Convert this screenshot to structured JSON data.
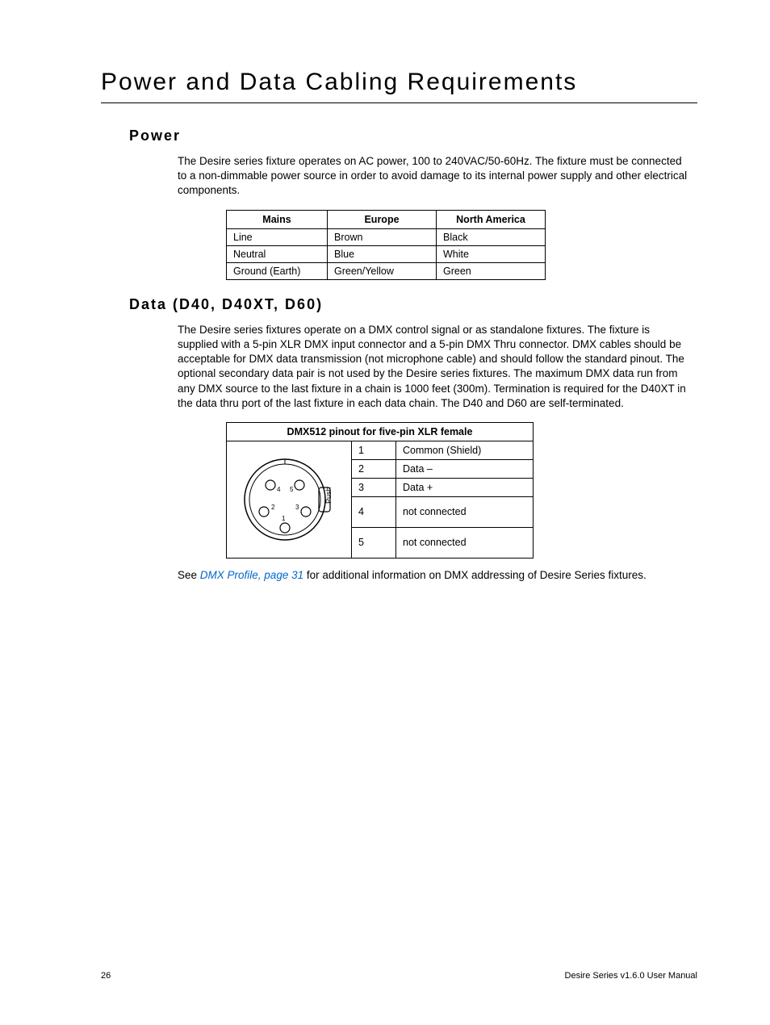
{
  "page_title": "Power and Data Cabling Requirements",
  "sections": {
    "power": {
      "heading": "Power",
      "paragraph": "The Desire series fixture operates on AC power, 100 to 240VAC/50-60Hz. The fixture must be connected to a non-dimmable power source in order to avoid damage to its internal power supply and other electrical components.",
      "table": {
        "headers": [
          "Mains",
          "Europe",
          "North America"
        ],
        "rows": [
          [
            "Line",
            "Brown",
            "Black"
          ],
          [
            "Neutral",
            "Blue",
            "White"
          ],
          [
            "Ground (Earth)",
            "Green/Yellow",
            "Green"
          ]
        ]
      }
    },
    "data": {
      "heading": "Data (D40, D40XT, D60)",
      "paragraph": "The Desire series fixtures operate on a DMX control signal or as standalone fixtures. The fixture is supplied with a 5-pin XLR DMX input connector and a 5-pin DMX Thru connector. DMX cables should be acceptable for DMX data transmission (not microphone cable) and should follow the standard pinout. The optional secondary data pair is not used by the Desire series fixtures. The maximum DMX data run from any DMX source to the last fixture in a chain is 1000 feet (300m). Termination is required for the D40XT in the data thru port of the last fixture in each data chain. The D40 and D60 are self-terminated.",
      "table": {
        "header": "DMX512 pinout for five-pin XLR female",
        "rows": [
          [
            "1",
            "Common (Shield)"
          ],
          [
            "2",
            "Data –"
          ],
          [
            "3",
            "Data +"
          ],
          [
            "4",
            "not connected"
          ],
          [
            "5",
            "not connected"
          ]
        ],
        "diagram_label": "Push",
        "pin_labels": [
          "1",
          "2",
          "3",
          "4",
          "5"
        ]
      },
      "footer_text_prefix": "See ",
      "footer_link": "DMX Profile, page 31",
      "footer_text_suffix": " for additional information on DMX addressing of Desire Series fixtures."
    }
  },
  "footer": {
    "page_num": "26",
    "doc_title": "Desire Series v1.6.0 User Manual"
  }
}
